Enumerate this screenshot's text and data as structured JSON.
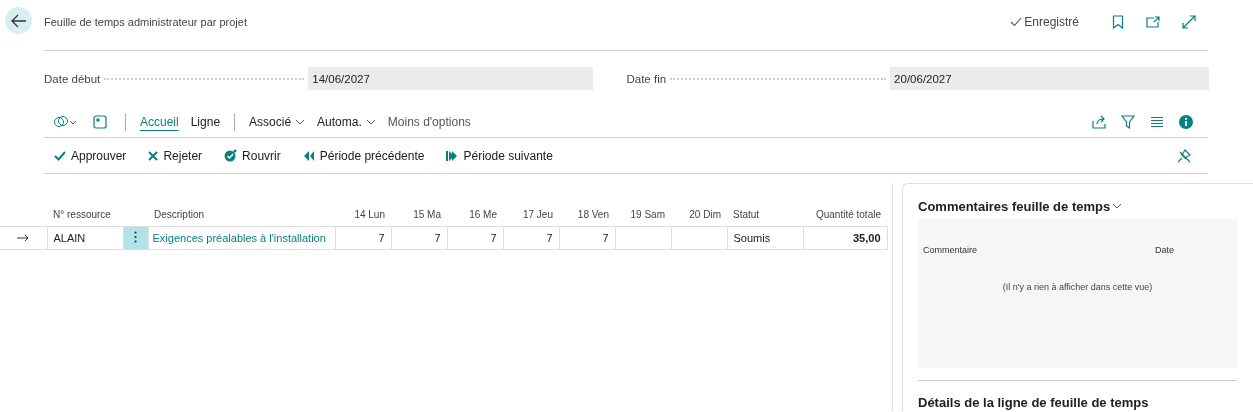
{
  "page": {
    "title": "Feuille de temps administrateur par projet",
    "save_status": "Enregistré"
  },
  "fields": [
    {
      "label": "Date début",
      "value": "14/06/2027"
    },
    {
      "label": "Date fin",
      "value": "20/06/2027"
    }
  ],
  "action_tabs": [
    {
      "label": "Accueil",
      "kind": "tab",
      "selected": true
    },
    {
      "label": "Ligne",
      "kind": "tab",
      "selected": false
    },
    {
      "label": "Associé",
      "kind": "menu",
      "selected": false
    },
    {
      "label": "Automa.",
      "kind": "menu",
      "selected": false
    },
    {
      "label": "Moins d'options",
      "kind": "link",
      "selected": false
    }
  ],
  "actions": [
    {
      "label": "Approuver",
      "kind": "approve"
    },
    {
      "label": "Rejeter",
      "kind": "reject"
    },
    {
      "label": "Rouvrir",
      "kind": "reopen"
    },
    {
      "label": "Période précédente",
      "kind": "previous"
    },
    {
      "label": "Période suivante",
      "kind": "next"
    }
  ],
  "table": {
    "columns": [
      "N° ressource",
      "Description",
      "14 Lun",
      "15 Ma",
      "16 Me",
      "17 Jeu",
      "18 Ven",
      "19 Sam",
      "20 Dim",
      "Statut",
      "Quantité totale"
    ],
    "rows": [
      {
        "selected": true,
        "resource": "ALAIN",
        "description": "Exigences préalables à l'installation",
        "days": [
          "7",
          "7",
          "7",
          "7",
          "7"
        ],
        "status": "Soumis",
        "total": "35,00"
      }
    ]
  },
  "factbox": {
    "comments_title": "Commentaires feuille de temps",
    "comment_columns": [
      "Commentaire",
      "Date"
    ],
    "empty_message": "(Il n'y a rien à afficher dans cette vue)",
    "details_title": "Détails de la ligne de feuille de temps"
  }
}
